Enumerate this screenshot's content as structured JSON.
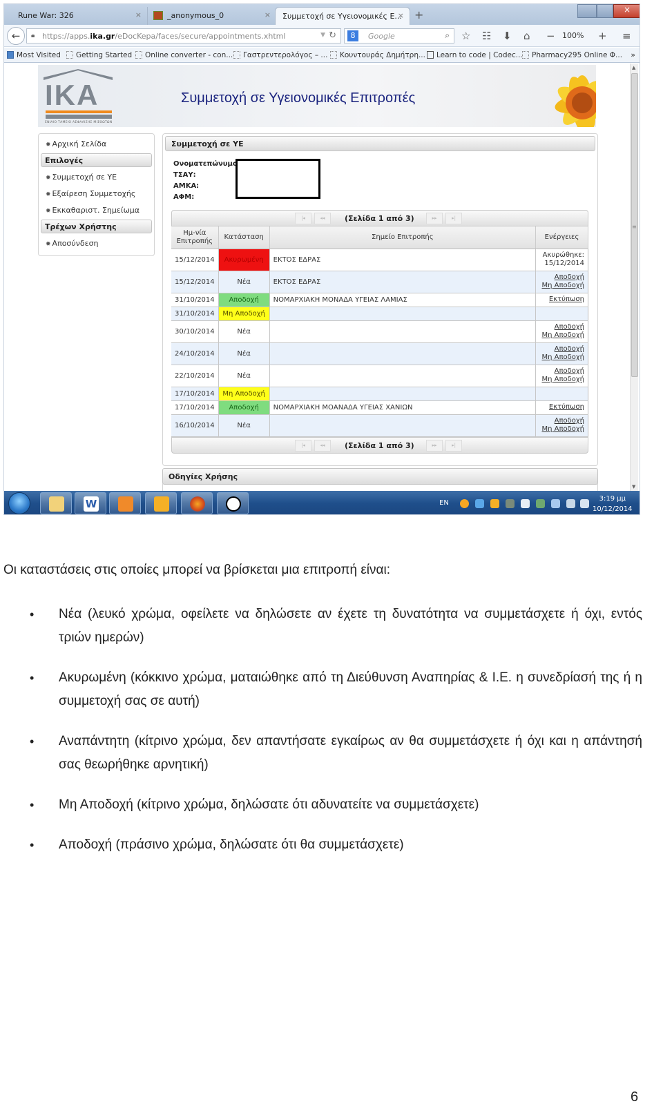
{
  "browser": {
    "tabs": [
      {
        "label": "Rune War: 326",
        "active": false
      },
      {
        "label": "_anonymous_0",
        "active": false
      },
      {
        "label": "Συμμετοχή σε Υγειονομικές Ε...",
        "active": true
      }
    ],
    "close_glyph": "×",
    "new_tab_glyph": "+",
    "url": {
      "prefix": "https://apps.",
      "domain": "ika.gr",
      "path": "/eDocKepa/faces/secure/appointments.xhtml"
    },
    "search_placeholder": "Google",
    "zoom_level": "100%",
    "zoom_minus": "−",
    "zoom_plus": "+",
    "bookmarks": [
      "Most Visited",
      "Getting Started",
      "Online converter - con...",
      "Γαστρεντερολόγος – ...",
      "Κουντουράς Δημήτρη...",
      "Learn to code | Codec...",
      "Pharmacy295 Online Φ..."
    ],
    "bookmarks_more": "»"
  },
  "site": {
    "logo_text": "IKA",
    "logo_subtitle": "ΕΝΙΑΙΟ ΤΑΜΕΙΟ ΑΣΦΑΛΙΣΗΣ ΜΙΣΘΩΤΩΝ",
    "banner_title": "Συμμετοχή σε Υγειονομικές Επιτροπές"
  },
  "sidebar": {
    "home": "Αρχική Σελίδα",
    "section_options": "Επιλογές",
    "options": [
      "Συμμετοχή σε ΥΕ",
      "Εξαίρεση Συμμετοχής",
      "Εκκαθαριστ. Σημείωμα"
    ],
    "section_user": "Τρέχων Χρήστης",
    "logout": "Αποσύνδεση"
  },
  "main": {
    "panel_title": "Συμμετοχή σε ΥΕ",
    "info_labels": [
      "Ονοματεπώνυμο:",
      "ΤΣΑΥ:",
      "ΑΜΚΑ:",
      "ΑΦΜ:"
    ],
    "pager": {
      "text": "(Σελίδα 1 από 3)",
      "current_page": 1,
      "total_pages": 3,
      "first": "|◂",
      "prev": "◂◂",
      "next": "▸▸",
      "last": "▸|"
    },
    "columns": [
      "Ημ-νία Επιτροπής",
      "Κατάσταση",
      "Σημείο Επιτροπής",
      "Ενέργειες"
    ],
    "rows": [
      {
        "date": "15/12/2014",
        "status": "Ακυρωμένη",
        "status_type": "cancel",
        "location": "ΕΚΤΟΣ ΕΔΡΑΣ",
        "action_text": "Ακυρώθηκε: 15/12/2014",
        "actions": []
      },
      {
        "date": "15/12/2014",
        "status": "Νέα",
        "status_type": "new",
        "location": "ΕΚΤΟΣ ΕΔΡΑΣ",
        "actions": [
          "Αποδοχή",
          "Μη Αποδοχή"
        ]
      },
      {
        "date": "31/10/2014",
        "status": "Αποδοχή",
        "status_type": "accept",
        "location": "ΝΟΜΑΡΧΙΑΚΗ ΜΟΝΑΔΑ ΥΓΕΙΑΣ ΛΑΜΙΑΣ",
        "actions": [
          "Εκτύπωση"
        ]
      },
      {
        "date": "31/10/2014",
        "status": "Μη Αποδοχή",
        "status_type": "reject",
        "location": "",
        "actions": []
      },
      {
        "date": "30/10/2014",
        "status": "Νέα",
        "status_type": "new",
        "location": "",
        "actions": [
          "Αποδοχή",
          "Μη Αποδοχή"
        ]
      },
      {
        "date": "24/10/2014",
        "status": "Νέα",
        "status_type": "new",
        "location": "",
        "actions": [
          "Αποδοχή",
          "Μη Αποδοχή"
        ]
      },
      {
        "date": "22/10/2014",
        "status": "Νέα",
        "status_type": "new",
        "location": "",
        "actions": [
          "Αποδοχή",
          "Μη Αποδοχή"
        ]
      },
      {
        "date": "17/10/2014",
        "status": "Μη Αποδοχή",
        "status_type": "reject",
        "location": "",
        "actions": []
      },
      {
        "date": "17/10/2014",
        "status": "Αποδοχή",
        "status_type": "accept",
        "location": "ΝΟΜΑΡΧΙΑΚΗ ΜΟΑΝΑΔΑ ΥΓΕΙΑΣ ΧΑΝΙΩΝ",
        "actions": [
          "Εκτύπωση"
        ]
      },
      {
        "date": "16/10/2014",
        "status": "Νέα",
        "status_type": "new",
        "location": "",
        "actions": [
          "Αποδοχή",
          "Μη Αποδοχή"
        ]
      }
    ],
    "guide_title": "Οδηγίες Χρήσης"
  },
  "taskbar": {
    "language": "EN",
    "time": "3:19 μμ",
    "date": "10/12/2014"
  },
  "document": {
    "intro": "Οι καταστάσεις στις οποίες μπορεί να βρίσκεται μια επιτροπή είναι:",
    "bullet_glyph": "•",
    "items": [
      "Νέα (λευκό χρώμα, οφείλετε να δηλώσετε αν έχετε τη δυνατότητα να συμμετάσχετε ή όχι, εντός τριών ημερών)",
      "Ακυρωμένη (κόκκινο χρώμα, ματαιώθηκε από τη Διεύθυνση Αναπηρίας & Ι.Ε. η συνεδρίασή της ή η συμμετοχή σας σε αυτή)",
      "Αναπάντητη (κίτρινο χρώμα, δεν απαντήσατε εγκαίρως αν θα συμμετάσχετε ή όχι και η απάντησή σας θεωρήθηκε αρνητική)",
      "Μη Αποδοχή (κίτρινο χρώμα, δηλώσατε ότι αδυνατείτε να συμμετάσχετε)",
      "Αποδοχή (πράσινο χρώμα, δηλώσατε ότι θα συμμετάσχετε)"
    ],
    "page_number": "6"
  },
  "colors": {
    "status_cancel": "#ee1111",
    "status_accept": "#7fdc7f",
    "status_reject": "#ffff1a",
    "banner_title": "#1a237e",
    "ika_orange": "#f08a1d"
  }
}
